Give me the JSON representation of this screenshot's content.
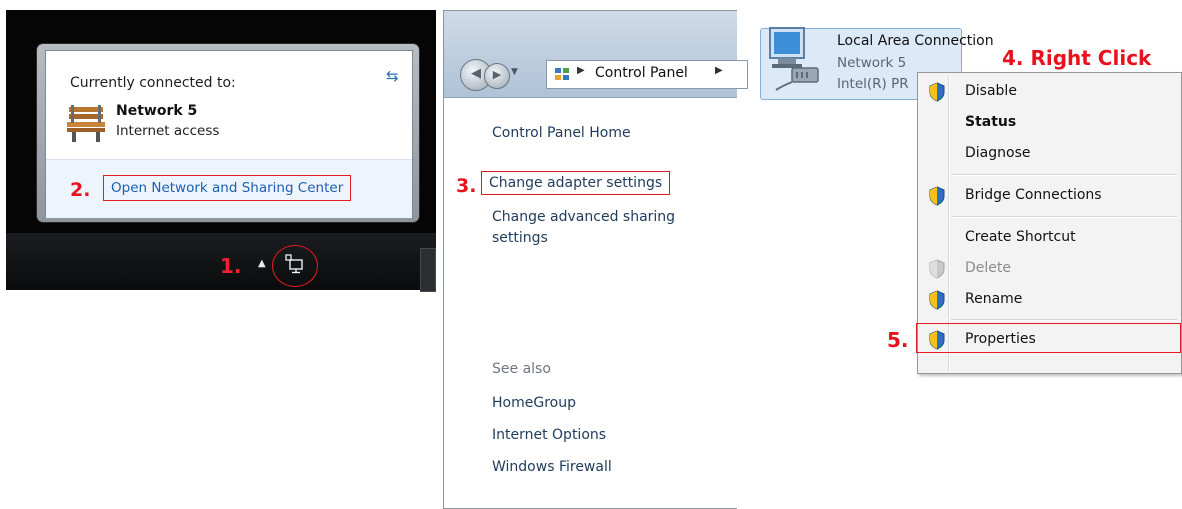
{
  "tray_flyout": {
    "header": "Currently connected to:",
    "network_name": "Network 5",
    "network_status": "Internet access",
    "link": "Open Network and Sharing Center",
    "step_label": "2."
  },
  "taskbar": {
    "step_label": "1."
  },
  "control_panel": {
    "breadcrumb": "Control Panel",
    "home": "Control Panel Home",
    "change_adapter": "Change adapter settings",
    "change_sharing": "Change advanced sharing settings",
    "step_label": "3.",
    "see_also": "See also",
    "see_also_links": [
      "HomeGroup",
      "Internet Options",
      "Windows Firewall"
    ]
  },
  "connection": {
    "name": "Local Area Connection",
    "network": "Network 5",
    "device": "Intel(R) PR",
    "step_label": "4. Right Click"
  },
  "context_menu": {
    "items": [
      {
        "label": "Disable",
        "icon": "shield-icon"
      },
      {
        "label": "Status",
        "icon": ""
      },
      {
        "label": "Diagnose",
        "icon": ""
      },
      {
        "label": "Bridge Connections",
        "icon": "shield-icon"
      },
      {
        "label": "Create Shortcut",
        "icon": ""
      },
      {
        "label": "Delete",
        "icon": "shield-disabled-icon"
      },
      {
        "label": "Rename",
        "icon": "shield-icon"
      },
      {
        "label": "Properties",
        "icon": "shield-icon"
      }
    ],
    "step_label": "5."
  },
  "colors": {
    "annotation_red": "#e8121e",
    "link_blue": "#1a5fb4",
    "taskbar_black": "#050505"
  }
}
